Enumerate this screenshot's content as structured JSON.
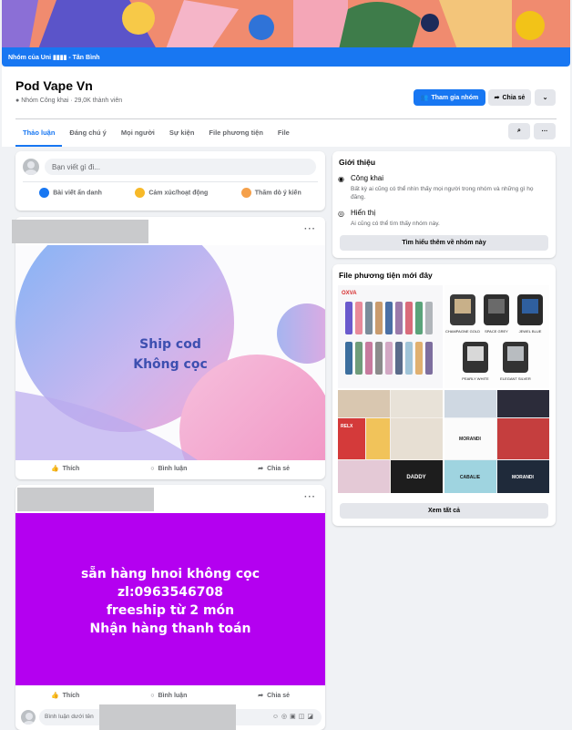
{
  "group_banner": "Nhóm của Uni ▮▮▮▮ - Tân Bình",
  "header": {
    "title": "Pod Vape Vn",
    "privacy": "Nhóm Công khai",
    "members": "29,0K thành viên",
    "join_label": "Tham gia nhóm",
    "share_label": "Chia sẻ",
    "tabs": [
      "Thảo luận",
      "Đáng chú ý",
      "Mọi người",
      "Sự kiện",
      "File phương tiện",
      "File"
    ]
  },
  "composer": {
    "placeholder": "Bạn viết gì đi...",
    "actions": [
      "Bài viết ẩn danh",
      "Cảm xúc/hoạt động",
      "Thăm dò ý kiến"
    ]
  },
  "post1": {
    "text_line1": "Ship cod",
    "text_line2": "Không cọc"
  },
  "post2": {
    "lines": [
      "sẵn hàng hnoi không cọc",
      "zl:0963546708",
      "freeship từ 2 món",
      "Nhận hàng thanh toán"
    ]
  },
  "post_actions": {
    "like": "Thích",
    "comment": "Bình luận",
    "share": "Chia sẻ"
  },
  "comment_placeholder": "Bình luận dưới tên",
  "about": {
    "heading": "Giới thiệu",
    "public_title": "Công khai",
    "public_desc": "Bất kỳ ai cũng có thể nhìn thấy mọi người trong nhóm và những gì họ đăng.",
    "visible_title": "Hiển thị",
    "visible_desc": "Ai cũng có thể tìm thấy nhóm này.",
    "learn_more": "Tìm hiểu thêm về nhóm này"
  },
  "media": {
    "heading": "File phương tiện mới đây",
    "see_all": "Xem tất cả",
    "brand1": "OXVA",
    "color_labels": [
      "CHAMPAGNE GOLD",
      "SPACE GREY",
      "JEWEL BLUE",
      "PEARLY WHITE",
      "ELEGANT SILVER"
    ],
    "thumb_labels": [
      "RELX",
      "MORANDI",
      "DADDY",
      "CABALIE",
      "MORANDI"
    ]
  },
  "colors": {
    "accent": "#1877f2",
    "purple": "#b400f0"
  }
}
